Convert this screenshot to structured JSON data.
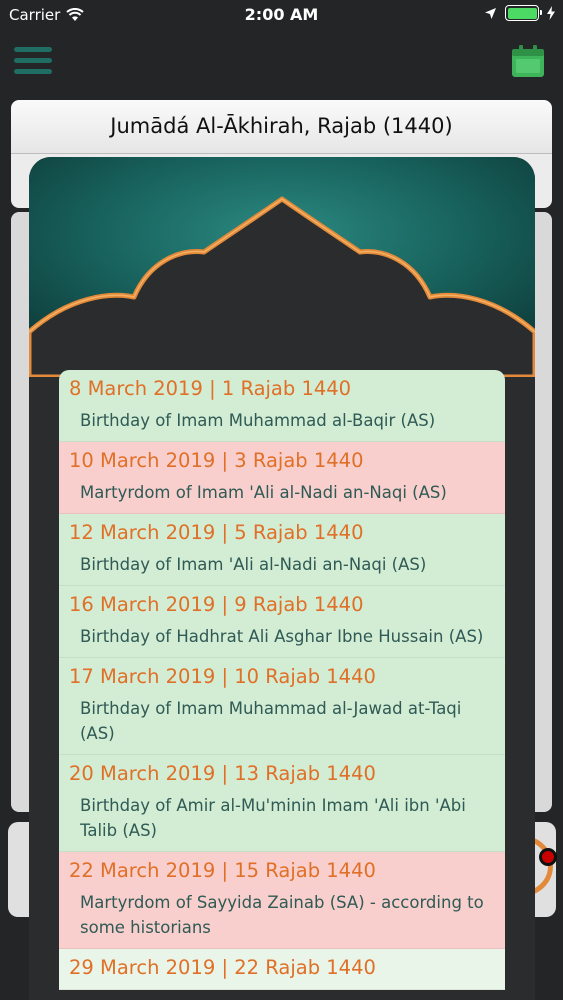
{
  "status_bar": {
    "carrier": "Carrier",
    "time": "2:00 AM"
  },
  "month_header": {
    "title": "Jumādá Al-Ākhirah, Rajab (1440)"
  },
  "colors": {
    "teal": "#1f6d63",
    "orange": "#e07027",
    "birthday_bg": "#d3ecd4",
    "martyrdom_bg": "#f8cfcd",
    "calendar_icon": "#3fb55b"
  },
  "events": [
    {
      "date": "8 March 2019 | 1 Rajab 1440",
      "description": "Birthday of Imam Muhammad al-Baqir (AS)",
      "kind": "birthday"
    },
    {
      "date": "10 March 2019 | 3 Rajab 1440",
      "description": "Martyrdom of Imam 'Ali al-Nadi an-Naqi (AS)",
      "kind": "martyrdom"
    },
    {
      "date": "12 March 2019 | 5 Rajab 1440",
      "description": "Birthday of Imam 'Ali al-Nadi an-Naqi (AS)",
      "kind": "birthday"
    },
    {
      "date": "16 March 2019 | 9 Rajab 1440",
      "description": "Birthday of Hadhrat Ali Asghar Ibne Hussain (AS)",
      "kind": "birthday"
    },
    {
      "date": "17 March 2019 | 10 Rajab 1440",
      "description": "Birthday of Imam Muhammad al-Jawad at-Taqi (AS)",
      "kind": "birthday"
    },
    {
      "date": "20 March 2019 | 13 Rajab 1440",
      "description": "Birthday of Amir al-Mu'minin Imam 'Ali ibn 'Abi Talib (AS)",
      "kind": "birthday"
    },
    {
      "date": "22 March 2019 | 15 Rajab 1440",
      "description": "Martyrdom of Sayyida Zainab (SA) - according to some historians",
      "kind": "martyrdom"
    },
    {
      "date": "29 March 2019 | 22 Rajab 1440",
      "description": "",
      "kind": "light"
    }
  ]
}
